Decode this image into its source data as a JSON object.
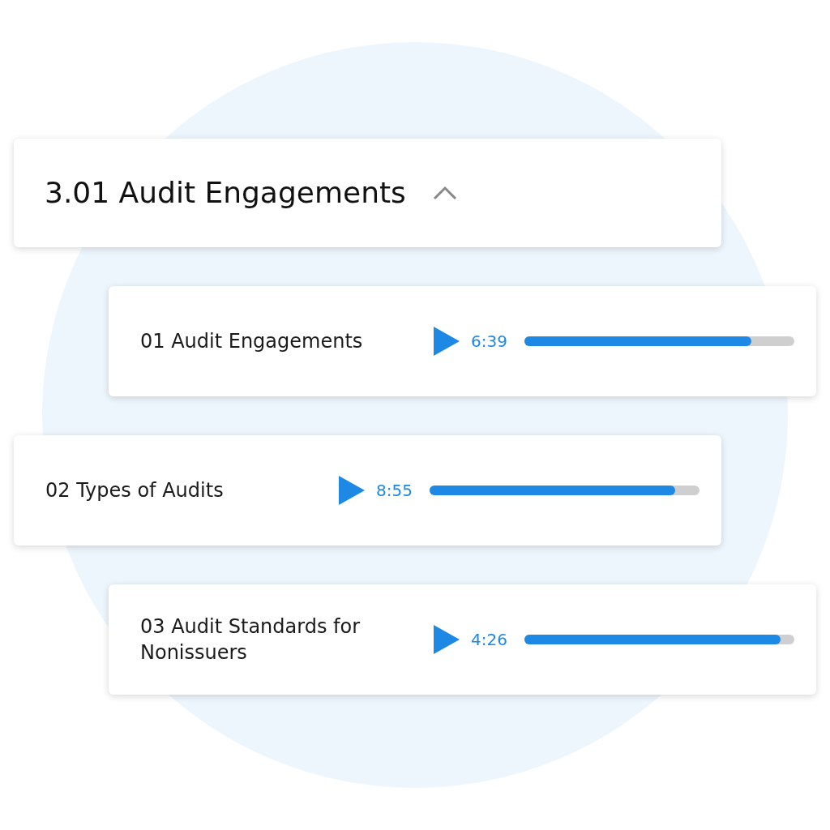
{
  "section": {
    "title": "3.01 Audit Engagements",
    "expanded": true
  },
  "lessons": [
    {
      "title": "01 Audit Engagements",
      "duration": "6:39",
      "level": 0.84
    },
    {
      "title": "02 Types of Audits",
      "duration": "8:55",
      "level": 0.91
    },
    {
      "title": "03 Audit Standards for Nonissuers",
      "duration": "4:26",
      "level": 0.95
    }
  ]
}
